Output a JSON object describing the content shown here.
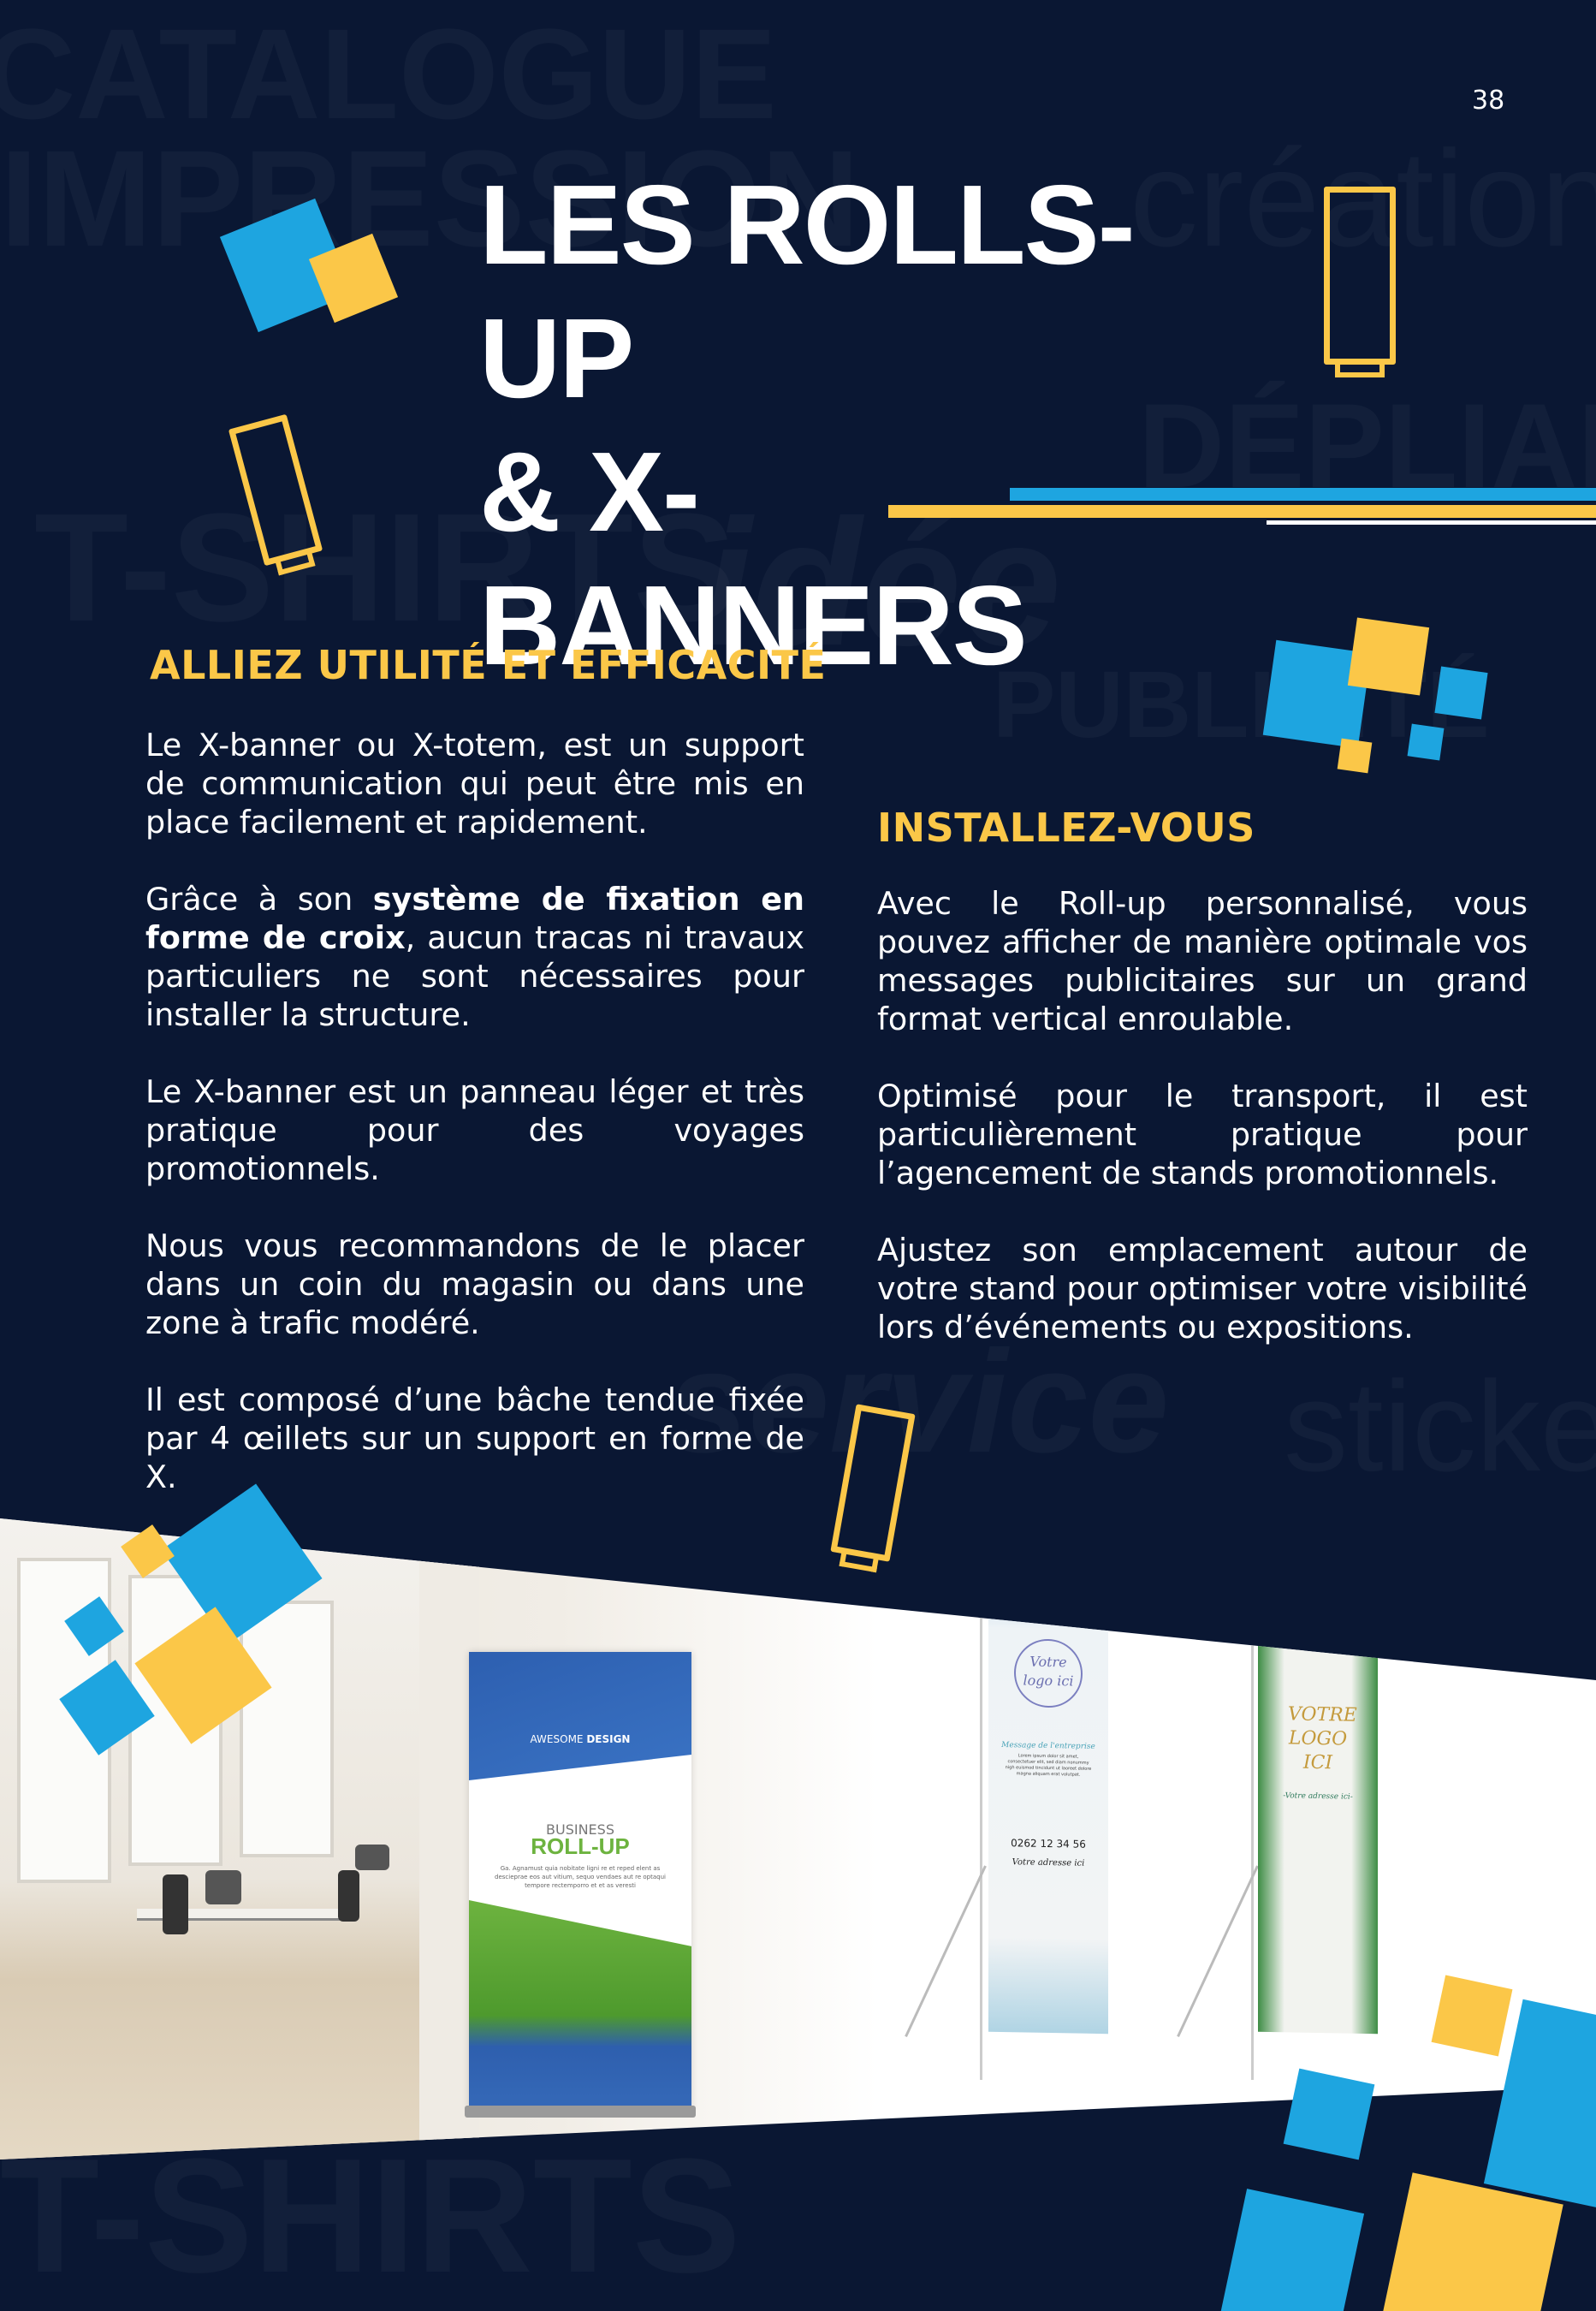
{
  "page_number": "38",
  "title": {
    "line1": "LES ROLLS-UP",
    "line2": "& X-BANNERS"
  },
  "colors": {
    "background": "#0a1733",
    "accent_yellow": "#fbc748",
    "accent_blue": "#1ea5e0",
    "text": "#ffffff"
  },
  "watermark_words": [
    "CATALOGUE",
    "IMPRESSION",
    "création",
    "T-SHIRTS",
    "idée",
    "DÉPLIANTS",
    "PUBLICITÉ",
    "service",
    "stickers"
  ],
  "left_section": {
    "heading": "ALLIEZ UTILITÉ ET EFFICACITÉ",
    "p1": "Le X-banner ou X-totem, est un support de communication qui peut être mis en place facilement et rapidement.",
    "p2_before": "Grâce à son ",
    "p2_bold": "système de fixation en forme de croix",
    "p2_after": ", aucun tracas ni travaux particuliers ne sont nécessaires pour installer la structure.",
    "p3": "Le X-banner est un panneau léger et très pratique pour des voyages promotionnels.",
    "p4": "Nous vous recommandons de le placer dans un coin du magasin ou dans une zone à trafic modéré.",
    "p5": "Il est composé d’une bâche tendue fixée par 4 œillets sur un support en forme de X."
  },
  "right_section": {
    "heading": "INSTALLEZ-VOUS",
    "p1": "Avec le Roll-up personnalisé, vous pouvez afficher de manière optimale vos messages publicitaires sur un grand format vertical enroulable.",
    "p2": "Optimisé pour le transport, il est particulièrement pratique pour l’agencement de stands promotionnels.",
    "p3": "Ajustez son emplacement autour de votre stand pour optimiser votre visibilité lors d’événements ou expositions."
  },
  "photo": {
    "rollup": {
      "tagline_light": "AWESOME ",
      "tagline_bold": "DESIGN",
      "kicker": "BUSINESS",
      "headline": "ROLL-UP",
      "body": "Ga. Agnamust quia nobitate ligni re et reped elent as descieprae eos aut vitium, sequo vendaes aut re optaqui tempore rectemporro et et as veresti"
    },
    "xbanner1": {
      "logo": "Votre logo ici",
      "message_title": "Message de l'entreprise",
      "message_body": "Lorem ipsum dolor sit amet, consectetuer elit, sed diam nonummy nigh euismod tincidunt ut laoreet dolore magna aliquam erat volutpat.",
      "phone": "0262 12 34 56",
      "address": "Votre adresse ici"
    },
    "xbanner2": {
      "logo": "VOTRE LOGO ICI",
      "address": "-Votre adresse ici-"
    }
  }
}
